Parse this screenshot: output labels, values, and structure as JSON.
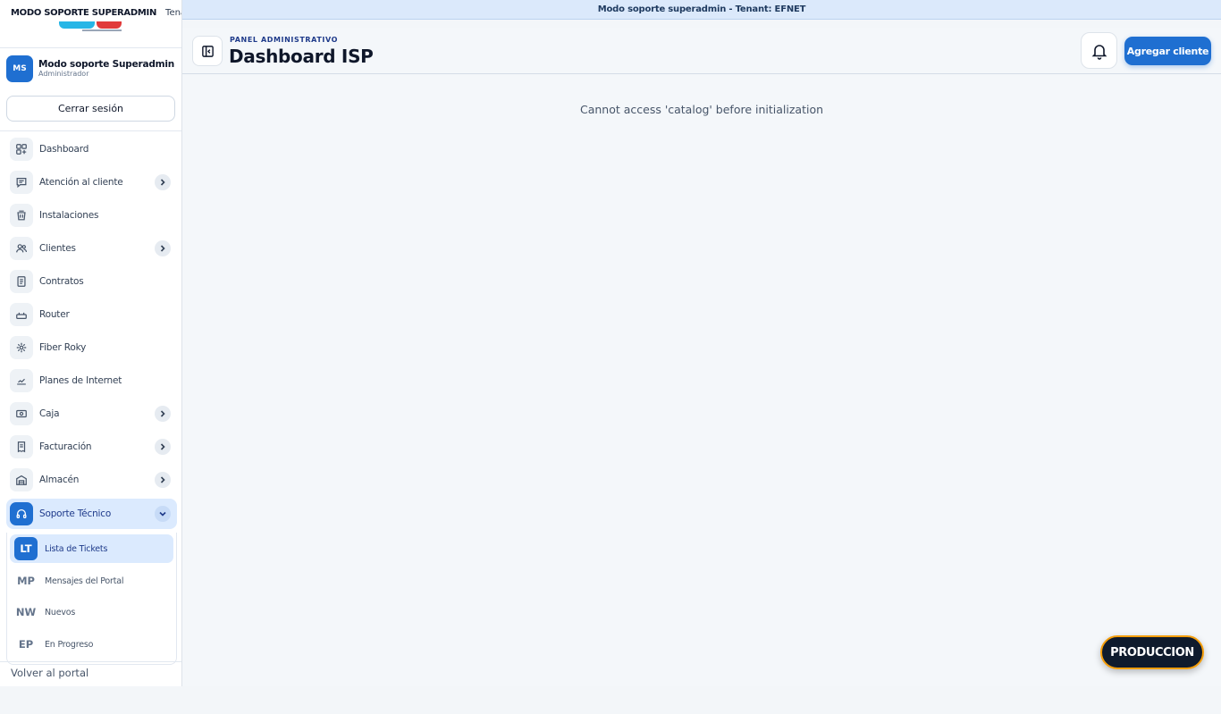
{
  "banner": {
    "sidebar_mode": "MODO SOPORTE SUPERADMIN",
    "sidebar_tenant": "Tenant",
    "main_text": "Modo soporte superadmin - Tenant: EFNET"
  },
  "user": {
    "initials": "MS",
    "name": "Modo soporte Superadmin",
    "role": "Administrador"
  },
  "logout_label": "Cerrar sesión",
  "nav": {
    "items": [
      {
        "label": "Dashboard",
        "icon": "dashboard-grid-icon"
      },
      {
        "label": "Atención al cliente",
        "icon": "chat-icon",
        "expandable": true
      },
      {
        "label": "Instalaciones",
        "icon": "bucket-icon"
      },
      {
        "label": "Clientes",
        "icon": "users-icon",
        "expandable": true
      },
      {
        "label": "Contratos",
        "icon": "document-icon"
      },
      {
        "label": "Router",
        "icon": "router-icon"
      },
      {
        "label": "Fiber Roky",
        "icon": "asterisk-icon"
      },
      {
        "label": "Planes de Internet",
        "icon": "speed-icon"
      },
      {
        "label": "Caja",
        "icon": "cash-icon",
        "expandable": true
      },
      {
        "label": "Facturación",
        "icon": "receipt-icon",
        "expandable": true
      },
      {
        "label": "Almacén",
        "icon": "warehouse-icon",
        "expandable": true
      },
      {
        "label": "Soporte Técnico",
        "icon": "headset-icon",
        "expandable": true,
        "active": true
      }
    ],
    "subitems": [
      {
        "abbr": "LT",
        "label": "Lista de Tickets",
        "active": true
      },
      {
        "abbr": "MP",
        "label": "Mensajes del Portal"
      },
      {
        "abbr": "NW",
        "label": "Nuevos"
      },
      {
        "abbr": "EP",
        "label": "En Progreso"
      }
    ],
    "back_label": "Volver al portal"
  },
  "header": {
    "eyebrow": "PANEL ADMINISTRATIVO",
    "title": "Dashboard ISP",
    "add_client_label": "Agregar cliente"
  },
  "main": {
    "error": "Cannot access 'catalog' before initialization"
  },
  "env_badge": "PRODUCCION",
  "colors": {
    "primary": "#1f6fd1",
    "banner": "#dbe9fb",
    "badge_bg": "#0f1b2d",
    "badge_border": "#f59e0b"
  }
}
